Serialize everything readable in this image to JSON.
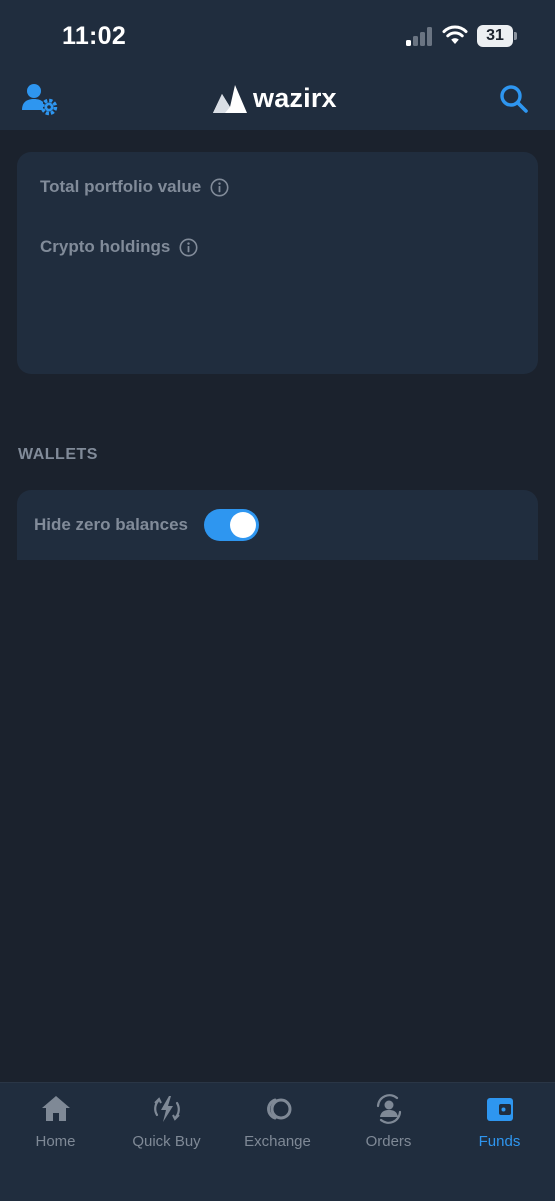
{
  "status_bar": {
    "time": "11:02",
    "battery": "31"
  },
  "header": {
    "logo_text": "wazirx"
  },
  "portfolio": {
    "total_label": "Total portfolio value",
    "holdings_label": "Crypto holdings"
  },
  "wallets": {
    "title": "WALLETS",
    "hide_zero_label": "Hide zero balances",
    "hide_zero_enabled": true
  },
  "nav": {
    "items": [
      {
        "label": "Home",
        "icon": "home-icon",
        "active": false
      },
      {
        "label": "Quick Buy",
        "icon": "quick-buy-icon",
        "active": false
      },
      {
        "label": "Exchange",
        "icon": "exchange-icon",
        "active": false
      },
      {
        "label": "Orders",
        "icon": "orders-icon",
        "active": false
      },
      {
        "label": "Funds",
        "icon": "wallet-icon",
        "active": true
      }
    ]
  },
  "colors": {
    "background": "#1b222d",
    "card": "#202d3e",
    "accent": "#2e96f0",
    "muted_text": "#818b99"
  }
}
